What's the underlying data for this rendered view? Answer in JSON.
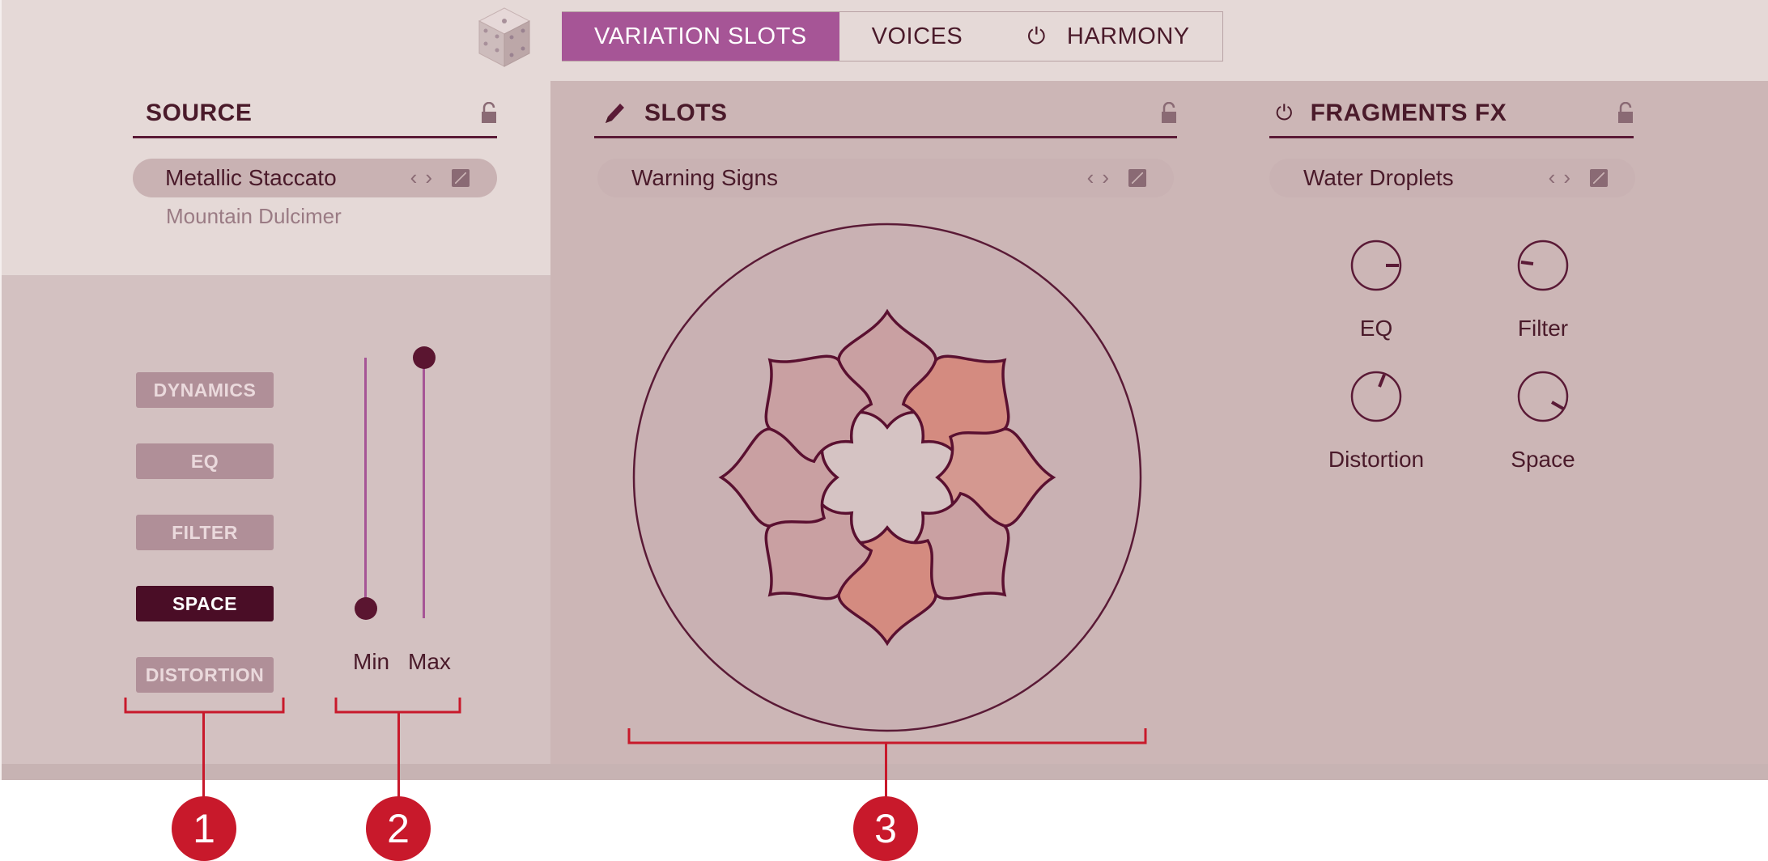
{
  "tabs": [
    {
      "label": "VARIATION SLOTS",
      "active": true
    },
    {
      "label": "VOICES",
      "active": false
    },
    {
      "label": "HARMONY",
      "active": false,
      "power_icon": "power-icon"
    }
  ],
  "source": {
    "title": "SOURCE",
    "preset": "Metallic Staccato",
    "sub": "Mountain Dulcimer"
  },
  "slots": {
    "title": "SLOTS",
    "preset": "Warning Signs"
  },
  "fragments_fx": {
    "title": "FRAGMENTS FX",
    "preset": "Water Droplets",
    "knobs": [
      {
        "label": "EQ"
      },
      {
        "label": "Filter"
      },
      {
        "label": "Distortion"
      },
      {
        "label": "Space"
      }
    ]
  },
  "params": [
    {
      "label": "DYNAMICS",
      "active": false
    },
    {
      "label": "EQ",
      "active": false
    },
    {
      "label": "FILTER",
      "active": false
    },
    {
      "label": "SPACE",
      "active": true
    },
    {
      "label": "DISTORTION",
      "active": false
    }
  ],
  "range": {
    "min_label": "Min",
    "max_label": "Max",
    "min_value": 0.0,
    "max_value": 1.0
  },
  "callouts": [
    "1",
    "2",
    "3"
  ],
  "colors": {
    "accent": "#a65596",
    "active_param": "#4a0d26",
    "callout": "#c8192b",
    "slot_highlight": "#d48b80"
  }
}
